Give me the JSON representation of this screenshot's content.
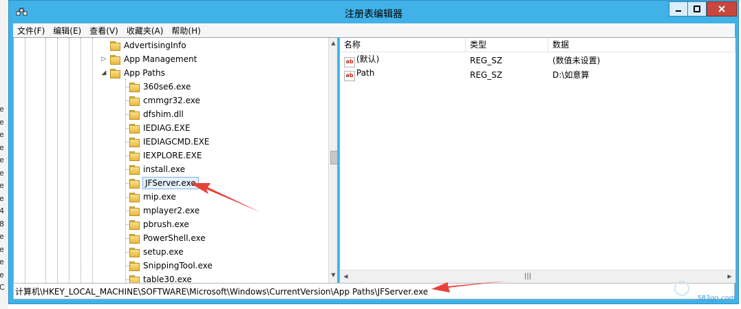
{
  "window": {
    "title": "注册表编辑器"
  },
  "menu": [
    "文件(F)",
    "编辑(E)",
    "查看(V)",
    "收藏夹(A)",
    "帮助(H)"
  ],
  "tree": {
    "parents": [
      {
        "label": "AdvertisingInfo",
        "expander": ""
      },
      {
        "label": "App Management",
        "expander": "▷"
      },
      {
        "label": "App Paths",
        "expander": "◢"
      }
    ],
    "children": [
      "360se6.exe",
      "cmmgr32.exe",
      "dfshim.dll",
      "IEDIAG.EXE",
      "IEDIAGCMD.EXE",
      "IEXPLORE.EXE",
      "install.exe",
      "JFServer.exe",
      "mip.exe",
      "mplayer2.exe",
      "pbrush.exe",
      "PowerShell.exe",
      "setup.exe",
      "SnippingTool.exe",
      "table30.exe"
    ],
    "selected_index": 7
  },
  "values": {
    "columns": [
      "名称",
      "类型",
      "数据"
    ],
    "rows": [
      {
        "name": "(默认)",
        "type": "REG_SZ",
        "data": "(数值未设置)",
        "icon": "string-value-icon"
      },
      {
        "name": "Path",
        "type": "REG_SZ",
        "data": "D:\\如意算",
        "icon": "string-value-icon"
      }
    ],
    "icon_text": "ab"
  },
  "status": {
    "path": "计算机\\HKEY_LOCAL_MACHINE\\SOFTWARE\\Microsoft\\Windows\\CurrentVersion\\App Paths\\JFServer.exe"
  },
  "watermark": "583go.com",
  "background_fragments": [
    "e",
    "e",
    "e",
    "e",
    "e",
    "e",
    "e",
    "e",
    "4",
    "8",
    "e",
    "e",
    "e",
    "e",
    "C"
  ],
  "colors": {
    "titlebar": "#41b2e8",
    "close": "#c7463e",
    "arrow": "#e8423a",
    "folder": "#e9b840"
  }
}
